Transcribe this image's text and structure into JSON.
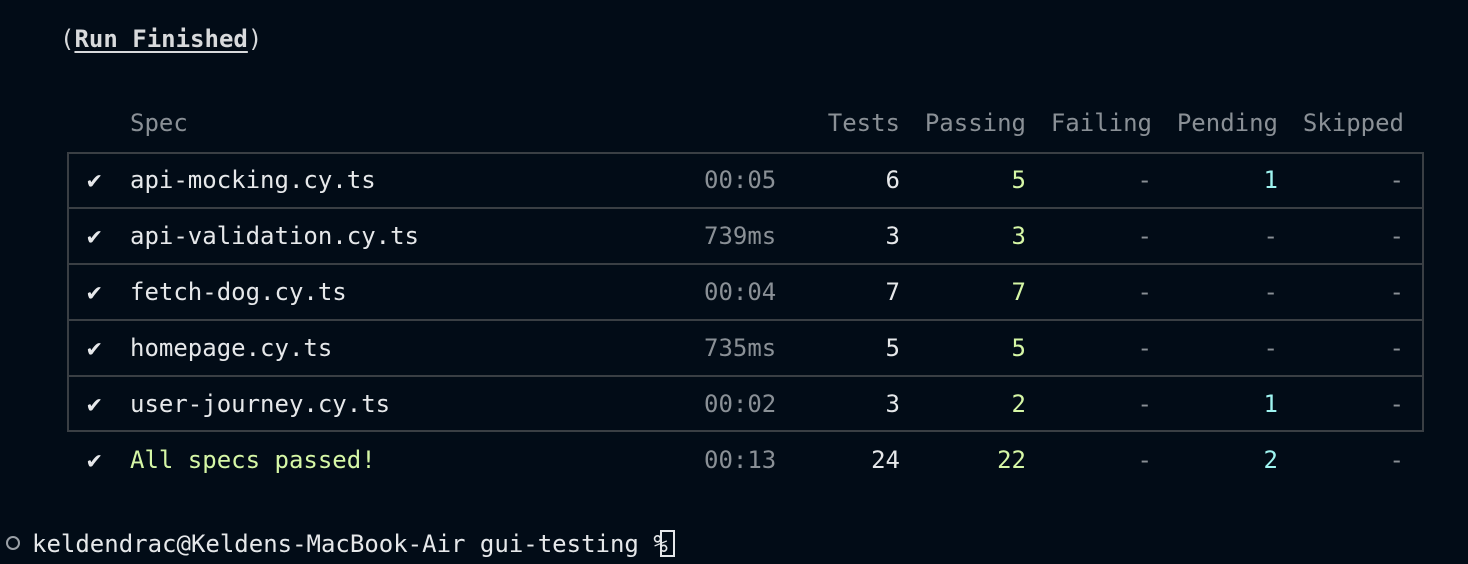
{
  "title": {
    "open": "(",
    "text": "Run Finished",
    "close": ")"
  },
  "headers": {
    "spec": "Spec",
    "tests": "Tests",
    "passing": "Passing",
    "failing": "Failing",
    "pending": "Pending",
    "skipped": "Skipped"
  },
  "check_glyph": "✔",
  "rows": [
    {
      "spec": "api-mocking.cy.ts",
      "duration": "00:05",
      "tests": "6",
      "passing": "5",
      "failing": "-",
      "pending": "1",
      "skipped": "-"
    },
    {
      "spec": "api-validation.cy.ts",
      "duration": "739ms",
      "tests": "3",
      "passing": "3",
      "failing": "-",
      "pending": "-",
      "skipped": "-"
    },
    {
      "spec": "fetch-dog.cy.ts",
      "duration": "00:04",
      "tests": "7",
      "passing": "7",
      "failing": "-",
      "pending": "-",
      "skipped": "-"
    },
    {
      "spec": "homepage.cy.ts",
      "duration": "735ms",
      "tests": "5",
      "passing": "5",
      "failing": "-",
      "pending": "-",
      "skipped": "-"
    },
    {
      "spec": "user-journey.cy.ts",
      "duration": "00:02",
      "tests": "3",
      "passing": "2",
      "failing": "-",
      "pending": "1",
      "skipped": "-"
    }
  ],
  "summary": {
    "spec": "All specs passed!",
    "duration": "00:13",
    "tests": "24",
    "passing": "22",
    "failing": "-",
    "pending": "2",
    "skipped": "-"
  },
  "prompt": {
    "text": "keldendrac@Keldens-MacBook-Air gui-testing % "
  },
  "colors": {
    "background": "#020c17",
    "passing": "#d6f7a6",
    "pending": "#9ff4f0",
    "muted": "#8a9096"
  }
}
